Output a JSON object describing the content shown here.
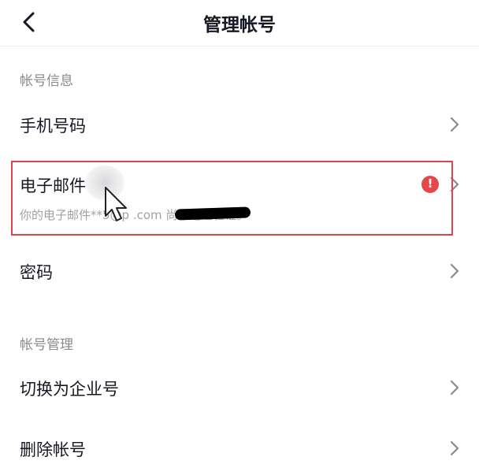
{
  "header": {
    "title": "管理帐号"
  },
  "sections": {
    "account_info": "帐号信息",
    "account_manage": "帐号管理"
  },
  "rows": {
    "phone": "手机号码",
    "email": "电子邮件",
    "email_notice": "你的电子邮件**5@p           .com 尚未通过验证。",
    "password": "密码",
    "switch_enterprise": "切换为企业号",
    "delete_account": "删除帐号"
  },
  "icons": {
    "back": "chevron-left-icon",
    "chevron": "chevron-right-icon",
    "warning": "exclamation-circle-icon",
    "cursor": "mouse-pointer-icon"
  },
  "colors": {
    "warning": "#e4474c",
    "highlight_border": "#e0454f"
  }
}
